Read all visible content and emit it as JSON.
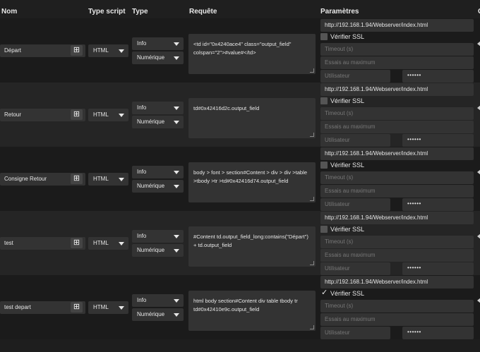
{
  "columns": [
    "Nom",
    "Type script",
    "Type",
    "Requête",
    "Paramètres",
    "C"
  ],
  "ssl_label": "Vérifier SSL",
  "timeout_placeholder": "Timeout (s)",
  "tries_placeholder": "Essais au maximum",
  "user_placeholder": "Utilisateur",
  "password_mask": "••••••",
  "rows": [
    {
      "name": "Départ",
      "script": "HTML",
      "type": "Info",
      "subtype": "Numérique",
      "query": "<td id=\"0x4240ace4\" class=\"output_field\" colspan=\"2\">#value#</td>",
      "url": "http://192.168.1.94/Webserver/index.html",
      "ssl_checked": false
    },
    {
      "name": "Retour",
      "script": "HTML",
      "type": "Info",
      "subtype": "Numérique",
      "query": "td#0x42416d2c.output_field",
      "url": "http://192.168.1.94/Webserver/index.html",
      "ssl_checked": false
    },
    {
      "name": "Consigne Retour",
      "script": "HTML",
      "type": "Info",
      "subtype": "Numérique",
      "query": "body > font > section#Content > div > div >table >tbody >tr >td#0x42416d74.output_field",
      "url": "http://192.168.1.94/Webserver/index.html",
      "ssl_checked": false
    },
    {
      "name": "test",
      "script": "HTML",
      "type": "Info",
      "subtype": "Numérique",
      "query": "#Content td.output_field_long:contains(\"Départ\") + td.output_field",
      "url": "http://192.168.1.94/Webserver/index.html",
      "ssl_checked": false
    },
    {
      "name": "test depart",
      "script": "HTML",
      "type": "Info",
      "subtype": "Numérique",
      "query": "html body section#Content div table tbody tr td#0x42410e9c.output_field",
      "url": "http://192.168.1.94/Webserver/index.html",
      "ssl_checked": true
    }
  ],
  "colors": {
    "background": "#1e1e1e",
    "field": "#333333",
    "text": "#e0e0e0",
    "placeholder": "#777777"
  },
  "icons": {
    "name_action": "sitemap-icon",
    "dropdown": "caret-down-icon",
    "checkbox": "checkbox-icon"
  }
}
